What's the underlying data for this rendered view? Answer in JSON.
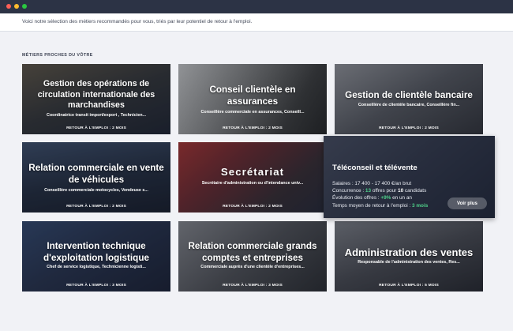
{
  "intro": "Voici notre sélection des métiers recommandés pour vous, triés par leur potentiel de retour à l'emploi.",
  "section_title": "MÉTIERS PROCHES DU VÔTRE",
  "cards": [
    {
      "title": "Gestion des opérations de circulation internationale des marchandises",
      "subtitle": "Coordinatrice transit import/export , Technicien...",
      "return": "RETOUR À L'EMPLOI : 2 MOIS"
    },
    {
      "title": "Conseil clientèle en assurances",
      "subtitle": "Conseillère commerciale en assurances, Conseill...",
      "return": "RETOUR À L'EMPLOI : 2 MOIS"
    },
    {
      "title": "Gestion de clientèle bancaire",
      "subtitle": "Conseillère de clientèle bancaire, Conseillère fin...",
      "return": "RETOUR À L'EMPLOI : 2 MOIS"
    },
    {
      "title": "Relation commerciale en vente de véhicules",
      "subtitle": "Conseillère commerciale motocycles, Vendeuse s...",
      "return": "RETOUR À L'EMPLOI : 2 MOIS"
    },
    {
      "title": "Secrétariat",
      "subtitle": "Secrétaire d'administration ou d'intendance univ...",
      "return": "RETOUR À L'EMPLOI : 2 MOIS"
    },
    {
      "title": "Intervention technique d'exploitation logistique",
      "subtitle": "Chef de service logistique, Technicienne logisti...",
      "return": "RETOUR À L'EMPLOI : 3 MOIS"
    },
    {
      "title": "Relation commerciale grands comptes et entreprises",
      "subtitle": "Commerciale auprès d'une clientèle d'entreprises...",
      "return": "RETOUR À L'EMPLOI : 3 MOIS"
    },
    {
      "title": "Administration des ventes",
      "subtitle": "Responsable de l'administration des ventes, Res...",
      "return": "RETOUR À L'EMPLOI : 5 MOIS"
    }
  ],
  "hover_card": {
    "title": "Téléconseil et télévente",
    "salary_label": "Salaires :",
    "salary_value": "17 400 - 17 400 €/an brut",
    "competition_label": "Concurrence :",
    "competition_offers": "13",
    "competition_mid": "offres pour",
    "competition_candidates": "10",
    "competition_end": "candidats",
    "evolution_label": "Évolution des offres :",
    "evolution_value": "+9%",
    "evolution_end": "en un an",
    "return_label": "Temps moyen de retour à l'emploi :",
    "return_value": "3 mois",
    "button": "Voir plus"
  }
}
